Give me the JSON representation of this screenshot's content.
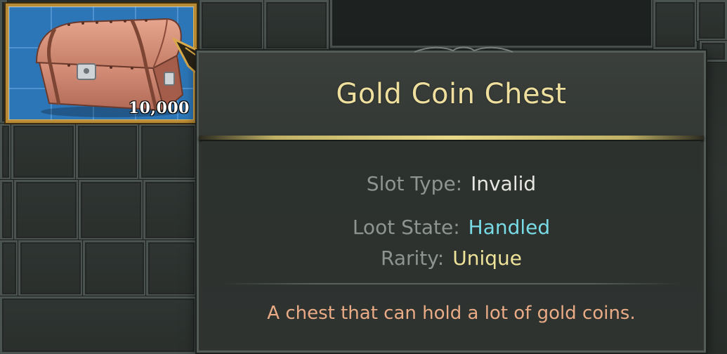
{
  "inventory": {
    "selected_item": {
      "quantity": "10,000",
      "icon": "treasure-chest-icon"
    }
  },
  "tooltip": {
    "title": "Gold Coin Chest",
    "stats": [
      {
        "label": "Slot Type",
        "sep": ":",
        "value": "Invalid",
        "color": "#e6e6e2"
      },
      {
        "label": "Loot State",
        "sep": ":",
        "value": "Handled",
        "color": "#78dbe6"
      },
      {
        "label": "Rarity",
        "sep": ":",
        "value": "Unique",
        "color": "#efe39a"
      }
    ],
    "description": "A chest that can hold a lot of gold coins."
  },
  "colors": {
    "title": "#eedf9e",
    "rarity_unique": "#efe39a",
    "loot_handled": "#78dbe6",
    "description": "#e9ab86",
    "selected_border": "#b98a35",
    "slot_highlight": "#2c76b7"
  }
}
